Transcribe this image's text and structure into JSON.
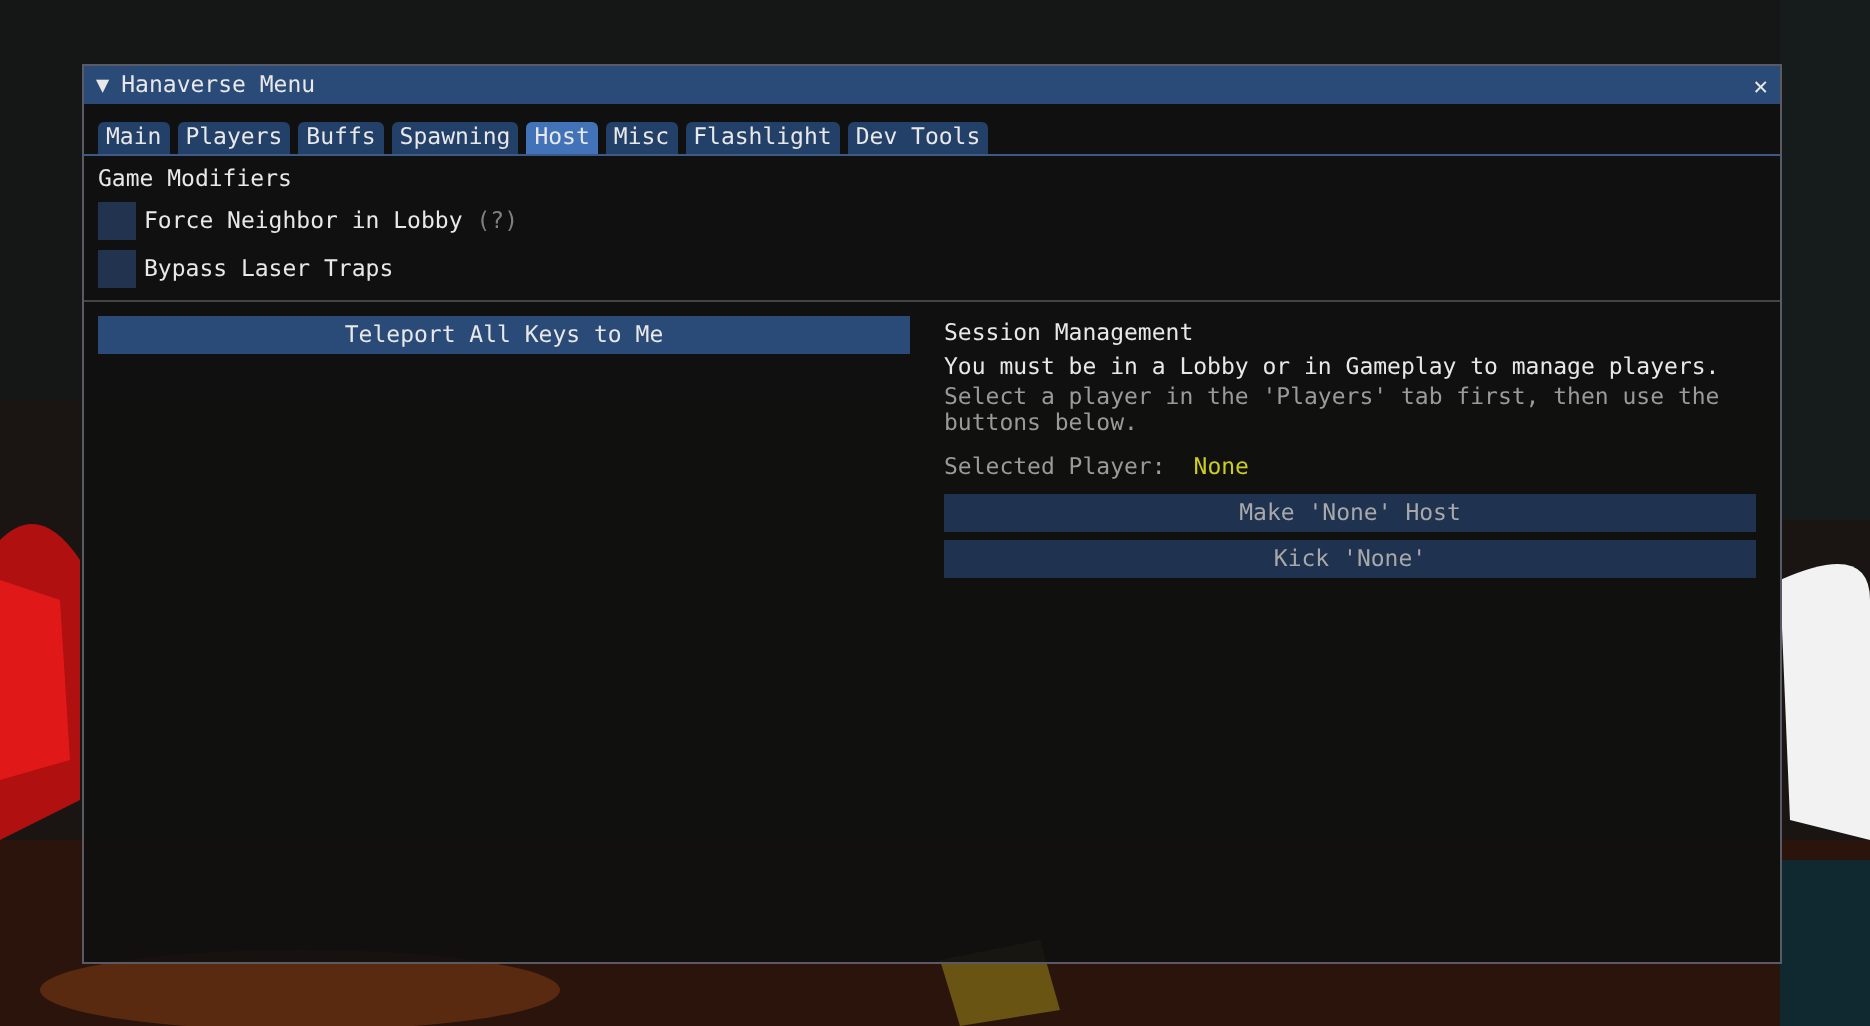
{
  "window": {
    "title": "Hanaverse Menu",
    "collapse_glyph": "▼",
    "close_glyph": "✕"
  },
  "tabs": [
    {
      "label": "Main",
      "selected": false
    },
    {
      "label": "Players",
      "selected": false
    },
    {
      "label": "Buffs",
      "selected": false
    },
    {
      "label": "Spawning",
      "selected": false
    },
    {
      "label": "Host",
      "selected": true
    },
    {
      "label": "Misc",
      "selected": false
    },
    {
      "label": "Flashlight",
      "selected": false
    },
    {
      "label": "Dev Tools",
      "selected": false
    }
  ],
  "game_modifiers": {
    "heading": "Game Modifiers",
    "options": [
      {
        "label": "Force Neighbor in Lobby",
        "help": "(?)",
        "checked": false
      },
      {
        "label": "Bypass Laser Traps",
        "checked": false
      }
    ]
  },
  "left_buttons": [
    "Teleport All Keys to Me"
  ],
  "session": {
    "heading": "Session Management",
    "notice": "You must be in a Lobby or in Gameplay to manage players.",
    "hint": "Select a player in the 'Players' tab first, then use the buttons below.",
    "selected_label": "Selected Player:",
    "selected_value": "None",
    "buttons": [
      {
        "label": "Make 'None' Host",
        "disabled": true
      },
      {
        "label": "Kick 'None'",
        "disabled": true
      }
    ]
  }
}
